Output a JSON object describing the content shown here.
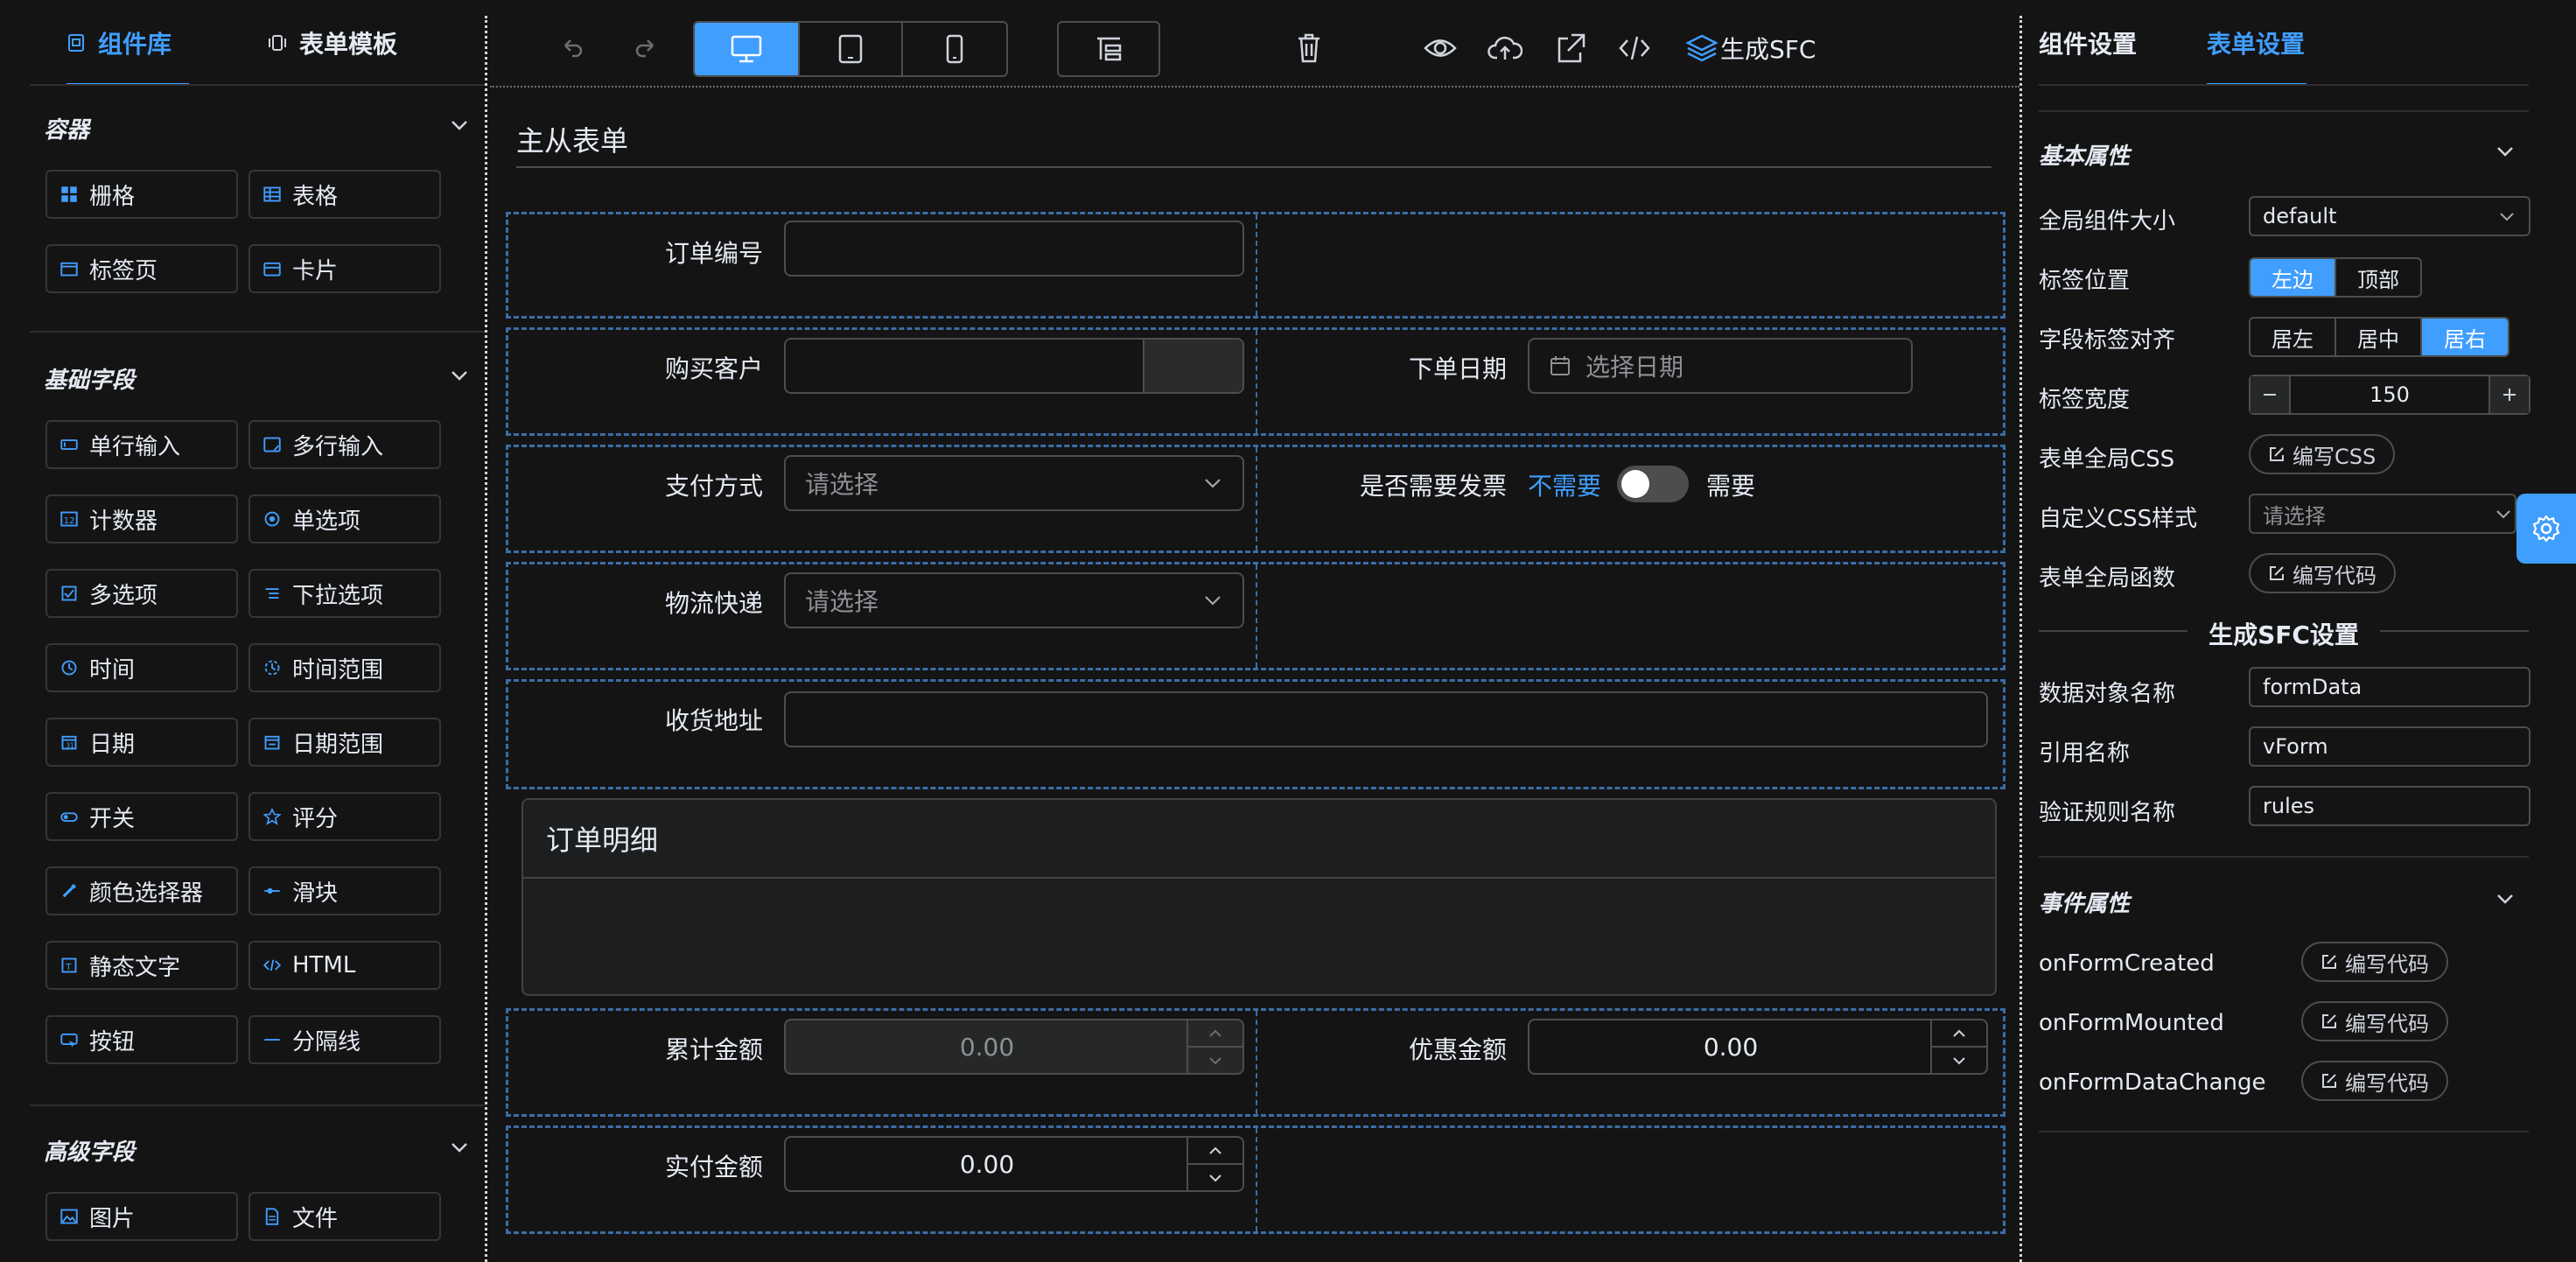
{
  "left_tabs": {
    "components": "组件库",
    "templates": "表单模板"
  },
  "groups": [
    {
      "title": "容器",
      "items": [
        {
          "label": "栅格",
          "icon": "grid-icon"
        },
        {
          "label": "表格",
          "icon": "table-icon"
        },
        {
          "label": "标签页",
          "icon": "tabs-icon"
        },
        {
          "label": "卡片",
          "icon": "card-icon"
        }
      ]
    },
    {
      "title": "基础字段",
      "items": [
        {
          "label": "单行输入",
          "icon": "input-icon"
        },
        {
          "label": "多行输入",
          "icon": "textarea-icon"
        },
        {
          "label": "计数器",
          "icon": "number-icon"
        },
        {
          "label": "单选项",
          "icon": "radio-icon"
        },
        {
          "label": "多选项",
          "icon": "checkbox-icon"
        },
        {
          "label": "下拉选项",
          "icon": "select-icon"
        },
        {
          "label": "时间",
          "icon": "time-icon"
        },
        {
          "label": "时间范围",
          "icon": "time-range-icon"
        },
        {
          "label": "日期",
          "icon": "date-icon"
        },
        {
          "label": "日期范围",
          "icon": "date-range-icon"
        },
        {
          "label": "开关",
          "icon": "switch-icon"
        },
        {
          "label": "评分",
          "icon": "rate-icon"
        },
        {
          "label": "颜色选择器",
          "icon": "color-picker-icon"
        },
        {
          "label": "滑块",
          "icon": "slider-icon"
        },
        {
          "label": "静态文字",
          "icon": "static-text-icon"
        },
        {
          "label": "HTML",
          "icon": "html-icon"
        },
        {
          "label": "按钮",
          "icon": "button-icon"
        },
        {
          "label": "分隔线",
          "icon": "divider-icon"
        }
      ]
    },
    {
      "title": "高级字段",
      "items": [
        {
          "label": "图片",
          "icon": "picture-icon"
        },
        {
          "label": "文件",
          "icon": "file-icon"
        }
      ]
    }
  ],
  "toolbar": {
    "generate_sfc": "生成SFC"
  },
  "form": {
    "title": "主从表单",
    "order_no": {
      "label": "订单编号",
      "value": ""
    },
    "customer": {
      "label": "购买客户",
      "value": ""
    },
    "order_date": {
      "label": "下单日期",
      "placeholder": "选择日期"
    },
    "payment": {
      "label": "支付方式",
      "placeholder": "请选择"
    },
    "invoice": {
      "label": "是否需要发票",
      "off_text": "不需要",
      "on_text": "需要",
      "checked": false
    },
    "logistics": {
      "label": "物流快递",
      "placeholder": "请选择"
    },
    "address": {
      "label": "收货地址",
      "value": ""
    },
    "detail_card_title": "订单明细",
    "total": {
      "label": "累计金额",
      "value": "0.00"
    },
    "discount": {
      "label": "优惠金额",
      "value": "0.00"
    },
    "paid": {
      "label": "实付金额",
      "value": "0.00"
    }
  },
  "right_tabs": {
    "component": "组件设置",
    "form": "表单设置"
  },
  "settings": {
    "basic_title": "基本属性",
    "size_label": "全局组件大小",
    "size_value": "default",
    "label_pos_label": "标签位置",
    "label_pos_options": [
      "左边",
      "顶部"
    ],
    "label_pos_selected": "左边",
    "align_label": "字段标签对齐",
    "align_options": [
      "居左",
      "居中",
      "居右"
    ],
    "align_selected": "居右",
    "width_label": "标签宽度",
    "width_value": "150",
    "css_label": "表单全局CSS",
    "css_btn": "编写CSS",
    "custom_css_label": "自定义CSS样式",
    "custom_css_placeholder": "请选择",
    "func_label": "表单全局函数",
    "func_btn": "编写代码",
    "sfc_title": "生成SFC设置",
    "data_obj_label": "数据对象名称",
    "data_obj_value": "formData",
    "ref_label": "引用名称",
    "ref_value": "vForm",
    "rules_label": "验证规则名称",
    "rules_value": "rules",
    "event_title": "事件属性",
    "events": [
      {
        "name": "onFormCreated",
        "btn": "编写代码"
      },
      {
        "name": "onFormMounted",
        "btn": "编写代码"
      },
      {
        "name": "onFormDataChange",
        "btn": "编写代码"
      }
    ]
  },
  "colors": {
    "accent": "#409eff",
    "bg": "#141414",
    "border": "#4c4d4f",
    "dashed": "#3a6ea5"
  }
}
